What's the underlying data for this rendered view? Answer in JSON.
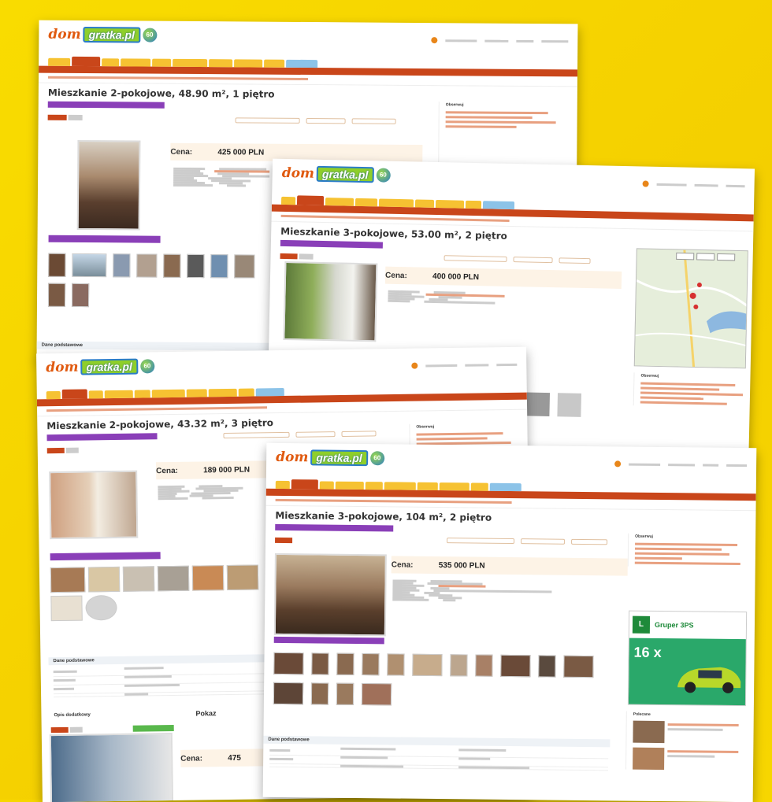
{
  "brand": {
    "dom": "dom",
    "gratka": "gratka.pl",
    "circle": "60"
  },
  "sheets": [
    {
      "title": "Mieszkanie 2-pokojowe, 48.90 m², 1 piętro",
      "price_label": "Cena:",
      "price": "425 000 PLN",
      "section": "Dane podstawowe",
      "side_heading": "Obserwuj"
    },
    {
      "title": "Mieszkanie 3-pokojowe, 53.00 m², 2 piętro",
      "price_label": "Cena:",
      "price": "400 000 PLN",
      "side_heading": "Obserwuj"
    },
    {
      "title": "Mieszkanie 2-pokojowe, 43.32 m², 3 piętro",
      "price_label": "Cena:",
      "price": "189 000 PLN",
      "section": "Dane podstawowe",
      "section2": "Opis dodatkowy",
      "price_label2": "Cena:",
      "price2": "475",
      "side_heading": "Obserwuj",
      "extra_right": "Pokaz"
    },
    {
      "title": "Mieszkanie 3-pokojowe, 104 m², 2 piętro",
      "price_label": "Cena:",
      "price": "535 000 PLN",
      "section": "Dane podstawowe",
      "side_heading": "Obserwuj",
      "ad_brand": "Gruper 3PS",
      "ad_big": "16 x",
      "side_heading2": "Polecane"
    }
  ],
  "colors": {
    "accent": "#c9461a",
    "tab": "#f6c232",
    "promo": "#8a3fb8",
    "bg": "#f7d700"
  }
}
